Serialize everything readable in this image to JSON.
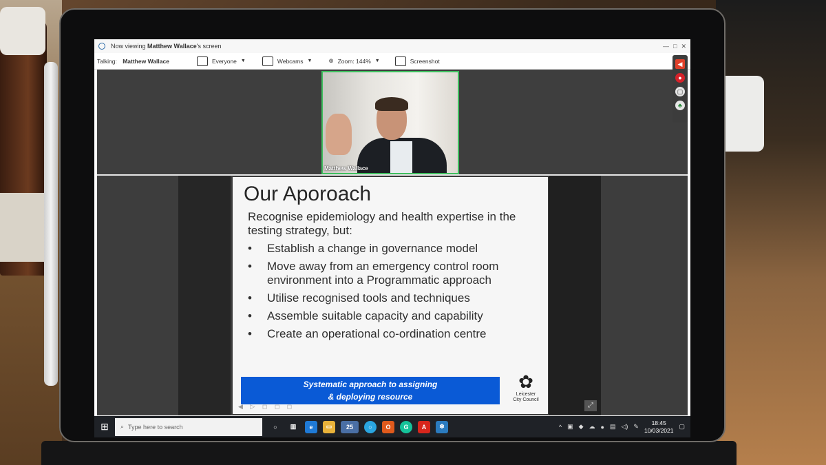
{
  "window": {
    "viewing_prefix": "Now viewing",
    "presenter": "Matthew Wallace",
    "viewing_suffix": "'s screen",
    "controls": [
      "—",
      "□",
      "✕"
    ]
  },
  "toolbar": {
    "talking_label": "Talking:",
    "talking_name": "Matthew Wallace",
    "audience_label": "Everyone",
    "webcams_label": "Webcams",
    "zoom_label": "Zoom: 144%",
    "screenshot_label": "Screenshot"
  },
  "webcam": {
    "name": "Matthew Wallace"
  },
  "slide": {
    "title": "Our Aporoach",
    "intro": "Recognise epidemiology and health expertise in the testing strategy, but:",
    "bullets": [
      "Establish a change in governance model",
      "Move away from an emergency control room environment into a Programmatic approach",
      "Utilise recognised tools and techniques",
      "Assemble suitable capacity and capability",
      "Create an operational co-ordination centre"
    ],
    "banner_line1": "Systematic approach to assigning",
    "banner_line2": "& deploying resource",
    "council_line1": "Leicester",
    "council_line2": "City Council"
  },
  "taskbar": {
    "search_placeholder": "Type here to search",
    "badge_count": "25",
    "time": "18:45",
    "date": "10/03/2021"
  },
  "colors": {
    "accent_green": "#3fbf5f",
    "banner_blue": "#0a5ad6",
    "taskbar": "#1f2227"
  }
}
